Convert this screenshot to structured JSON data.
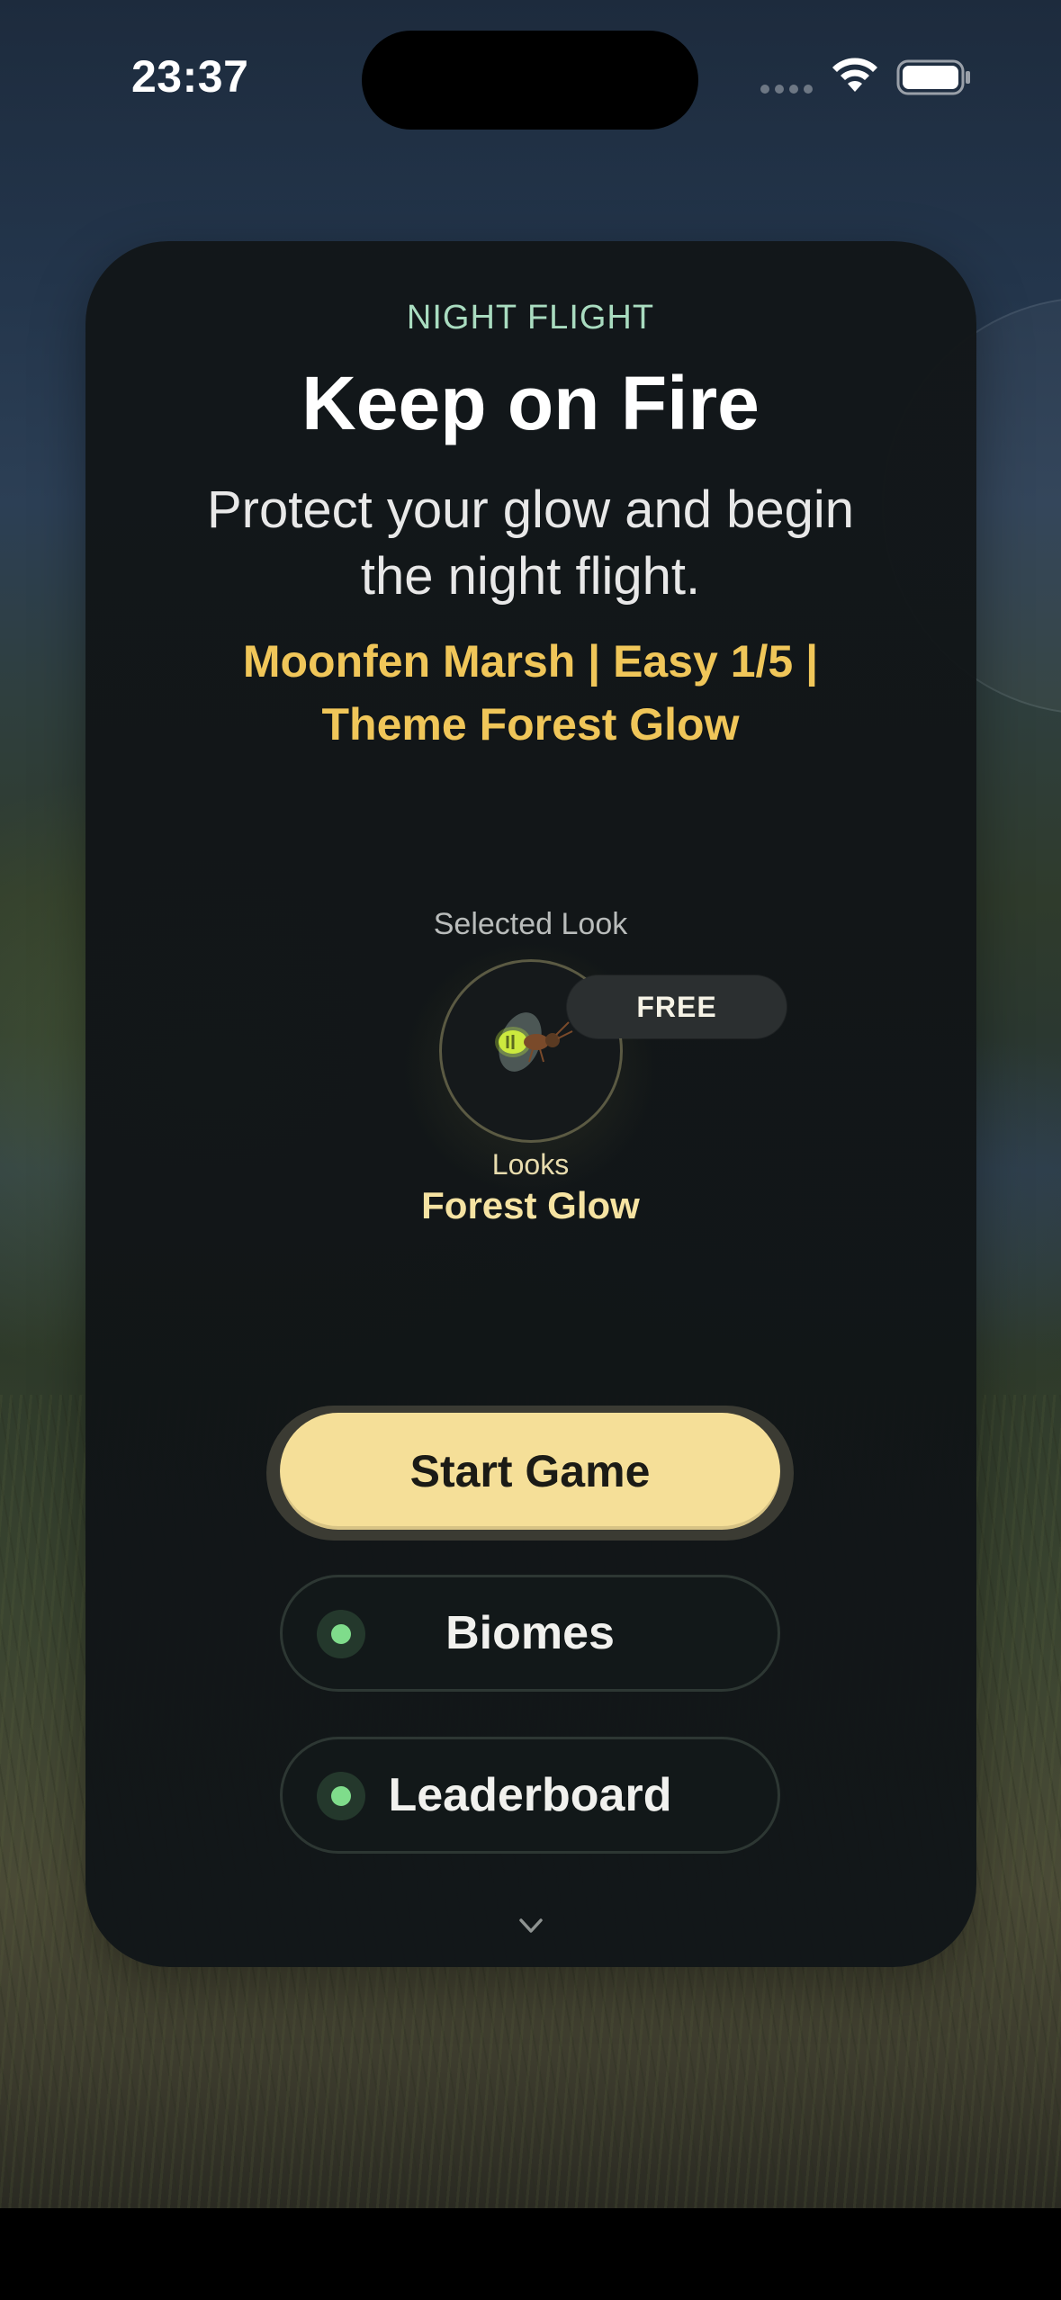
{
  "status_bar": {
    "time": "23:37"
  },
  "card": {
    "eyebrow": "NIGHT FLIGHT",
    "title": "Keep on Fire",
    "subtitle": "Protect your glow and begin the night flight.",
    "meta": "Moonfen Marsh | Easy 1/5 | Theme Forest Glow"
  },
  "look": {
    "label": "Selected Look",
    "badge": "FREE",
    "caption": "Looks",
    "name": "Forest Glow"
  },
  "buttons": {
    "start": "Start Game",
    "biomes": "Biomes",
    "leaderboard": "Leaderboard"
  },
  "colors": {
    "accent_gold": "#f0c659",
    "start_button": "#f5df98",
    "eyebrow_mint": "#a9dcc0",
    "indicator_green": "#7fdc8b",
    "card_bg": "#121618"
  },
  "icons": {
    "wifi": "wifi-icon",
    "battery": "battery-icon",
    "firefly": "firefly-icon",
    "more": "chevron-down-icon"
  }
}
